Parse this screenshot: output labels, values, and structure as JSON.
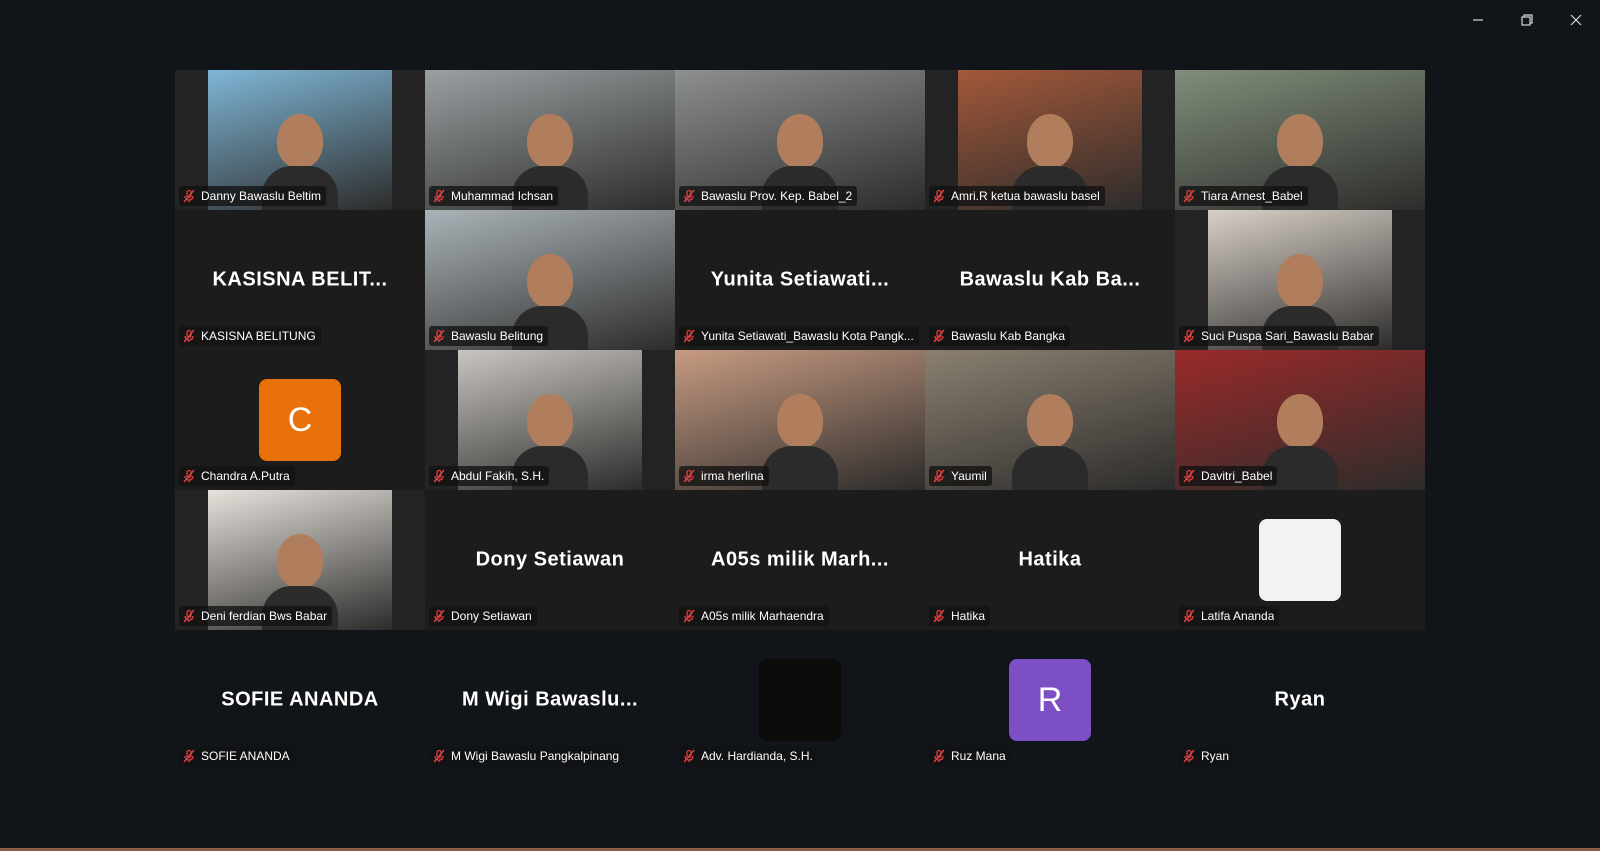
{
  "window": {
    "controls": {
      "minimize": "—",
      "restore": "❐",
      "close": "✕"
    }
  },
  "participants": [
    {
      "label": "Danny Bawaslu Beltim",
      "kind": "video",
      "frame_color": "#7fb6d6"
    },
    {
      "label": "Muhammad Ichsan",
      "kind": "video-full",
      "frame_color": "#9aa0a2"
    },
    {
      "label": "Bawaslu Prov. Kep. Babel_2",
      "kind": "video-full",
      "frame_color": "#8d8f90"
    },
    {
      "label": "Amri.R  ketua bawaslu basel",
      "kind": "video",
      "frame_color": "#a3583a"
    },
    {
      "label": "Tiara Arnest_Babel",
      "kind": "video-full",
      "frame_color": "#7f8e7a"
    },
    {
      "label": "KASISNA BELITUNG",
      "kind": "name",
      "display": "KASISNA  BELIT..."
    },
    {
      "label": "Bawaslu Belitung",
      "kind": "video-full",
      "frame_color": "#aab3b8"
    },
    {
      "label": "Yunita Setiawati_Bawaslu Kota Pangk...",
      "kind": "name",
      "display": "Yunita  Setiawati..."
    },
    {
      "label": "Bawaslu Kab Bangka",
      "kind": "name",
      "display": "Bawaslu  Kab  Ba..."
    },
    {
      "label": "Suci Puspa Sari_Bawaslu Babar",
      "kind": "video",
      "frame_color": "#d8d0c8"
    },
    {
      "label": "Chandra A.Putra",
      "kind": "avatar",
      "initial": "C",
      "color": "#e8710a"
    },
    {
      "label": "Abdul Fakih, S.H.",
      "kind": "video",
      "frame_color": "#c9c6c1"
    },
    {
      "label": "irma herlina",
      "kind": "video-full",
      "frame_color": "#c79b82"
    },
    {
      "label": "Yaumil",
      "kind": "video-full",
      "frame_color": "#8a8070"
    },
    {
      "label": "Davitri_Babel",
      "kind": "video-full",
      "frame_color": "#9a2a2a",
      "active": true
    },
    {
      "label": "Deni ferdian Bws Babar",
      "kind": "video",
      "frame_color": "#e6e2dc"
    },
    {
      "label": "Dony Setiawan",
      "kind": "name",
      "display": "Dony Setiawan"
    },
    {
      "label": "A05s milik Marhaendra",
      "kind": "name",
      "display": "A05s  milik  Marh..."
    },
    {
      "label": "Hatika",
      "kind": "name",
      "display": "Hatika"
    },
    {
      "label": "Latifa Ananda",
      "kind": "avatar",
      "initial": "",
      "color": "#f2f2f2"
    },
    {
      "label": "SOFIE ANANDA",
      "kind": "name-blank",
      "display": "SOFIE ANANDA"
    },
    {
      "label": "M Wigi Bawaslu Pangkalpinang",
      "kind": "name-blank",
      "display": "M  Wigi  Bawaslu..."
    },
    {
      "label": "Adv. Hardianda, S.H.",
      "kind": "avatar-dark",
      "initial": "",
      "color": "#0c0c0c"
    },
    {
      "label": "Ruz Mana",
      "kind": "avatar-blank",
      "initial": "R",
      "color": "#7d4fc4"
    },
    {
      "label": "Ryan",
      "kind": "name-blank",
      "display": "Ryan"
    }
  ],
  "colors": {
    "background": "#111418",
    "active_speaker_border": "#22c55e",
    "muted_icon": "#e04040"
  },
  "icons": {
    "muted": "mic-off-icon"
  }
}
